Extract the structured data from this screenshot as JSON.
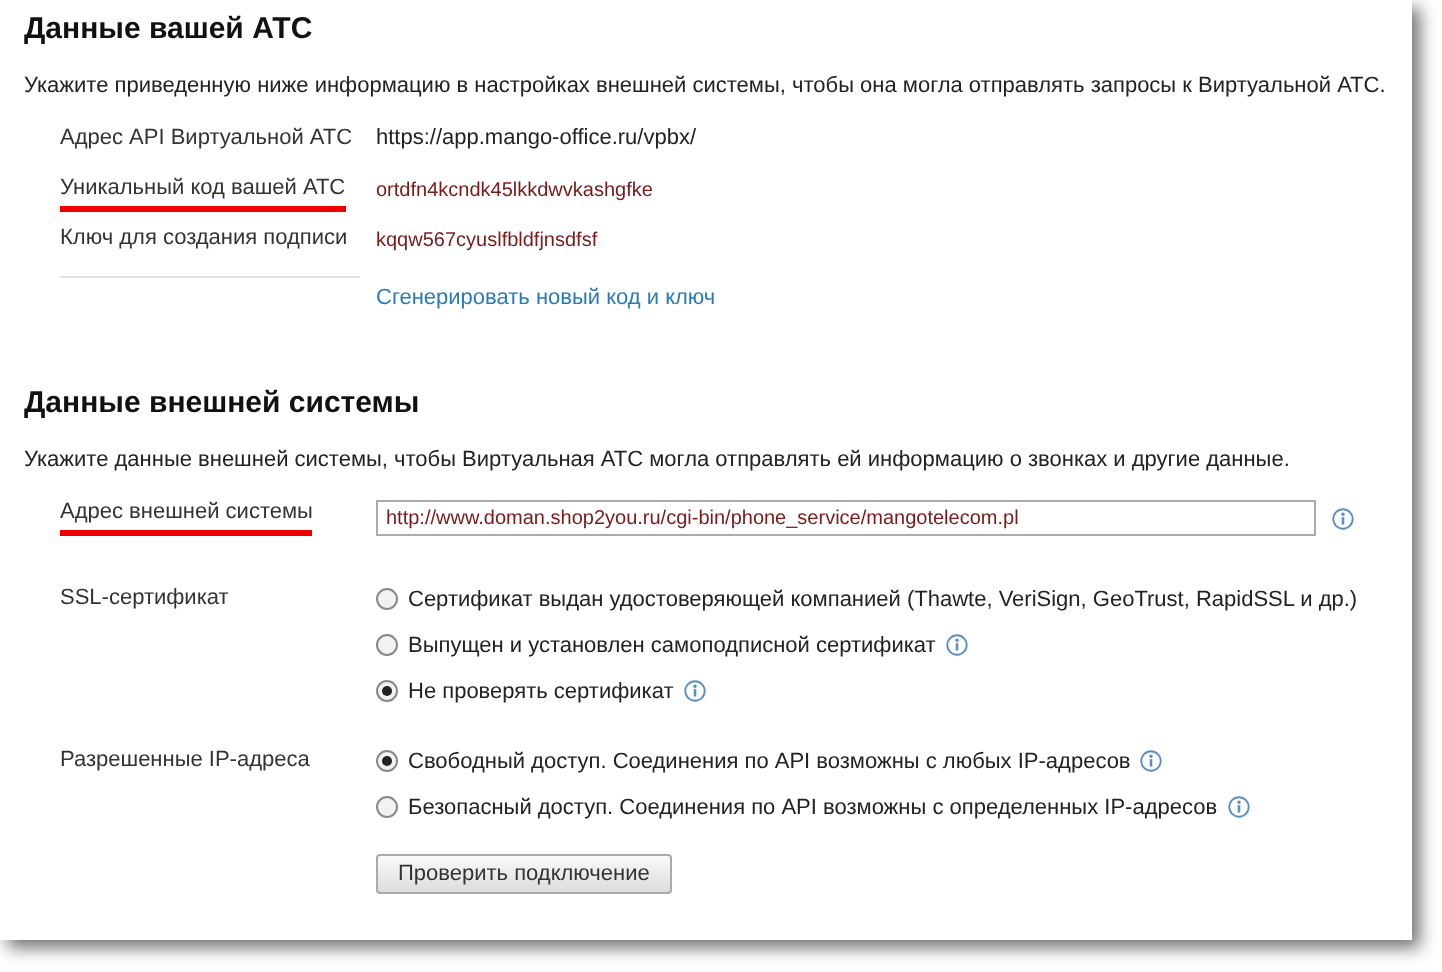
{
  "pbx_section": {
    "title": "Данные вашей АТС",
    "description": "Укажите приведенную ниже информацию в настройках внешней системы, чтобы она могла отправлять запросы к Виртуальной АТС.",
    "rows": [
      {
        "label": "Адрес API Виртуальной АТС",
        "value": "https://app.mango-office.ru/vpbx/",
        "kind": "url",
        "highlighted": false
      },
      {
        "label": "Уникальный код вашей АТС",
        "value": "ortdfn4kcndk45lkkdwvkashgfke",
        "kind": "code",
        "highlighted": true
      },
      {
        "label": "Ключ для создания подписи",
        "value": "kqqw567cyuslfbldfjnsdfsf",
        "kind": "code",
        "highlighted": false
      }
    ],
    "link": "Сгенерировать новый код и ключ"
  },
  "external_section": {
    "title": "Данные внешней системы",
    "description": "Укажите данные внешней системы, чтобы Виртуальная АТС могла отправлять ей информацию о звонках и другие данные.",
    "address": {
      "label": "Адрес внешней системы",
      "value": "http://www.doman.shop2you.ru/cgi-bin/phone_service/mangotelecom.pl",
      "highlighted": true
    },
    "groups": [
      {
        "label": "SSL-сертификат",
        "options": [
          {
            "label": "Сертификат выдан удостоверяющей компанией (Thawte, VeriSign, GeoTrust, RapidSSL и др.)",
            "selected": false,
            "info": false
          },
          {
            "label": "Выпущен и установлен самоподписной сертификат",
            "selected": false,
            "info": true
          },
          {
            "label": "Не проверять сертификат",
            "selected": true,
            "info": true
          }
        ]
      },
      {
        "label": "Разрешенные IP-адреса",
        "options": [
          {
            "label": "Свободный доступ. Соединения по API возможны с любых IP-адресов",
            "selected": true,
            "info": true
          },
          {
            "label": "Безопасный доступ. Соединения по API возможны с определенных IP-адресов",
            "selected": false,
            "info": true
          }
        ]
      }
    ],
    "button": "Проверить подключение"
  }
}
